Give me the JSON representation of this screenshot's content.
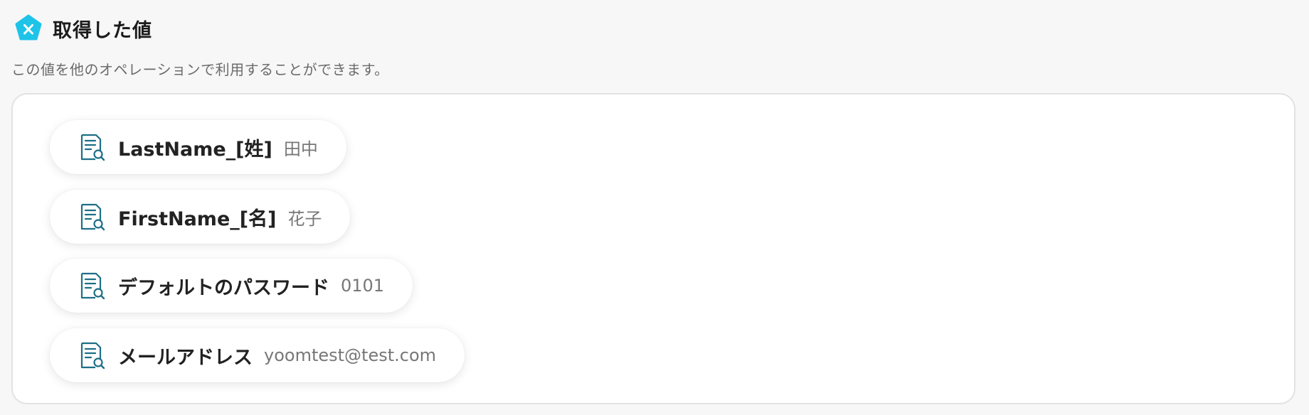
{
  "header": {
    "icon": "x-badge-icon",
    "title": "取得した値",
    "accent_color": "#1ec3e8"
  },
  "description": "この値を他のオペレーションで利用することができます。",
  "values": [
    {
      "label": "LastName_[姓]",
      "value": "田中",
      "icon": "document-search-icon"
    },
    {
      "label": "FirstName_[名]",
      "value": "花子",
      "icon": "document-search-icon"
    },
    {
      "label": "デフォルトのパスワード",
      "value": "0101",
      "icon": "document-search-icon"
    },
    {
      "label": "メールアドレス",
      "value": "yoomtest@test.com",
      "icon": "document-search-icon"
    }
  ],
  "icon_color": "#1d6f86"
}
